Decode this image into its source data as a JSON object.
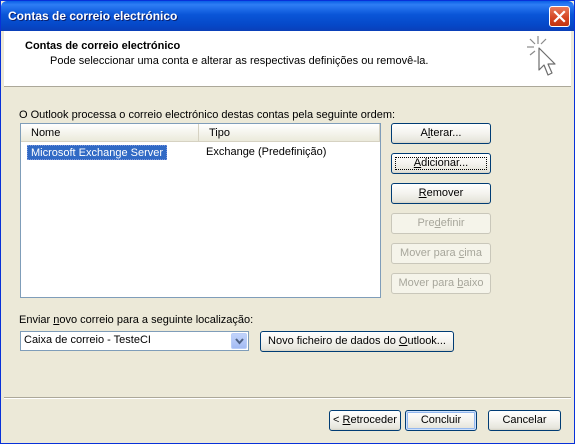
{
  "window": {
    "title": "Contas de correio electrónico"
  },
  "header": {
    "title": "Contas de correio electrónico",
    "subtitle": "Pode seleccionar uma conta e alterar as respectivas definições ou removê-la.",
    "icon": "cursor-sparkle-icon"
  },
  "accounts": {
    "caption": "O Outlook processa o correio electrónico destas contas pela seguinte ordem:",
    "columns": [
      "Nome",
      "Tipo"
    ],
    "rows": [
      {
        "name": "Microsoft Exchange Server",
        "type": "Exchange (Predefinição)"
      }
    ]
  },
  "actions": {
    "change": {
      "pre": "A",
      "key": "l",
      "post": "terar..."
    },
    "add": {
      "pre": "",
      "key": "A",
      "post": "dicionar..."
    },
    "remove": {
      "pre": "",
      "key": "R",
      "post": "emover"
    },
    "set_default": {
      "pre": "Pre",
      "key": "d",
      "post": "efinir"
    },
    "move_up": {
      "pre": "Mover para ",
      "key": "c",
      "post": "ima"
    },
    "move_down": {
      "pre": "Mover para ",
      "key": "b",
      "post": "aixo"
    }
  },
  "delivery": {
    "caption_pre": "Enviar ",
    "caption_key": "n",
    "caption_post": "ovo correio para a seguinte localização:",
    "selected": "Caixa de correio - TesteCI",
    "new_data_file_pre": "Novo ficheiro de dados do ",
    "new_data_file_key": "O",
    "new_data_file_post": "utlook..."
  },
  "footer": {
    "back_pre": "< ",
    "back_key": "R",
    "back_post": "etroceder",
    "finish": "Concluir",
    "cancel": "Cancelar"
  },
  "colors": {
    "titlebar": "#0a56d8",
    "selection": "#316ac5",
    "dialog_bg": "#ece9d8"
  }
}
